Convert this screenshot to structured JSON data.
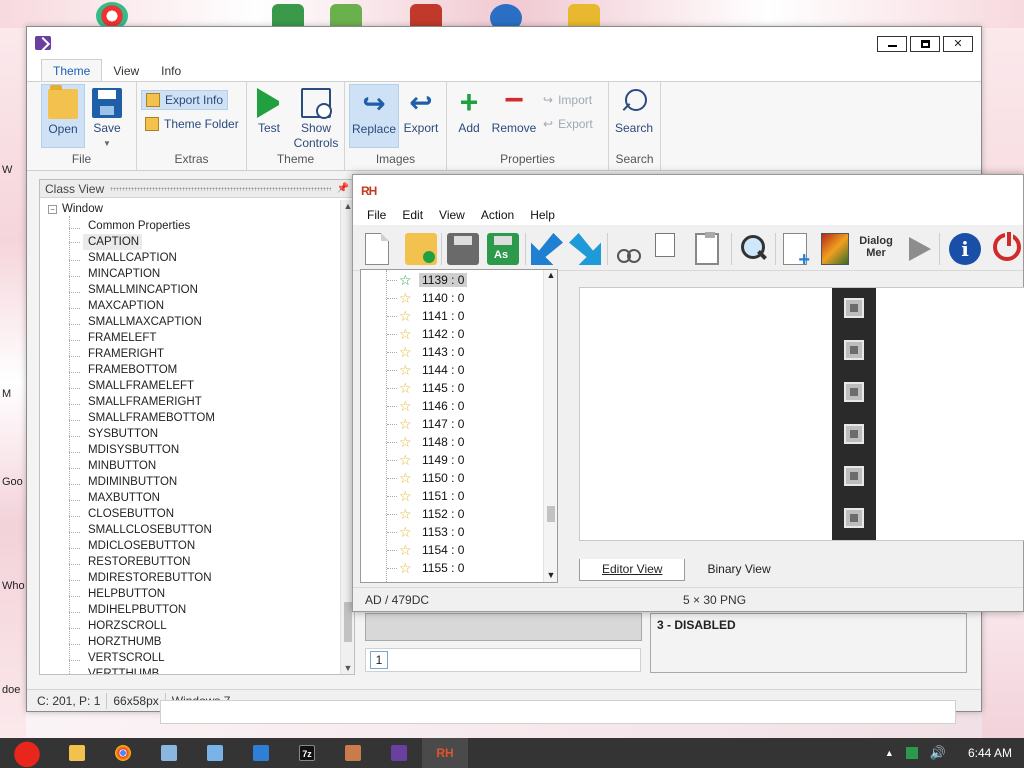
{
  "main_window": {
    "tabs": [
      "Theme",
      "View",
      "Info"
    ],
    "window_controls": {
      "minimize": "",
      "maximize": "",
      "close": "✕"
    },
    "ribbon": {
      "file": {
        "label": "File",
        "open": "Open",
        "save": "Save"
      },
      "extras": {
        "label": "Extras",
        "export_info": "Export Info",
        "theme_folder": "Theme Folder"
      },
      "theme": {
        "label": "Theme",
        "test": "Test",
        "show": "Show",
        "controls": "Controls"
      },
      "images": {
        "label": "Images",
        "replace": "Replace",
        "export": "Export"
      },
      "properties": {
        "label": "Properties",
        "add": "Add",
        "remove": "Remove",
        "import": "Import",
        "export": "Export"
      },
      "search": {
        "label": "Search",
        "search": "Search"
      }
    },
    "class_view": {
      "title": "Class View",
      "pin": "📌",
      "root": "Window",
      "items": [
        "Common Properties",
        "CAPTION",
        "SMALLCAPTION",
        "MINCAPTION",
        "SMALLMINCAPTION",
        "MAXCAPTION",
        "SMALLMAXCAPTION",
        "FRAMELEFT",
        "FRAMERIGHT",
        "FRAMEBOTTOM",
        "SMALLFRAMELEFT",
        "SMALLFRAMERIGHT",
        "SMALLFRAMEBOTTOM",
        "SYSBUTTON",
        "MDISYSBUTTON",
        "MINBUTTON",
        "MDIMINBUTTON",
        "MAXBUTTON",
        "CLOSEBUTTON",
        "SMALLCLOSEBUTTON",
        "MDICLOSEBUTTON",
        "RESTOREBUTTON",
        "MDIRESTOREBUTTON",
        "HELPBUTTON",
        "MDIHELPBUTTON",
        "HORZSCROLL",
        "HORZTHUMB",
        "VERTSCROLL",
        "VERTTHUMB"
      ]
    },
    "status": {
      "position": "C: 201, P: 1",
      "size": "66x58px",
      "os": "Windows 7"
    }
  },
  "rh_window": {
    "logo": "RH",
    "menu": [
      "File",
      "Edit",
      "View",
      "Action",
      "Help"
    ],
    "toolbar": {
      "dialog_label": "Dialog Mer"
    },
    "tree_items": [
      "1139 : 0",
      "1140 : 0",
      "1141 : 0",
      "1142 : 0",
      "1143 : 0",
      "1144 : 0",
      "1145 : 0",
      "1146 : 0",
      "1147 : 0",
      "1148 : 0",
      "1149 : 0",
      "1150 : 0",
      "1151 : 0",
      "1152 : 0",
      "1153 : 0",
      "1154 : 0",
      "1155 : 0"
    ],
    "tabs": [
      "Editor View",
      "Binary View"
    ],
    "status_left": "AD / 479DC",
    "status_right": "5 × 30  PNG"
  },
  "under_panels": {
    "state_label": "3 - DISABLED",
    "index": "1"
  },
  "taskbar": {
    "time": "6:44 AM"
  },
  "desktop_labels": [
    "W",
    "M",
    "Goo",
    "Who",
    "doe"
  ]
}
